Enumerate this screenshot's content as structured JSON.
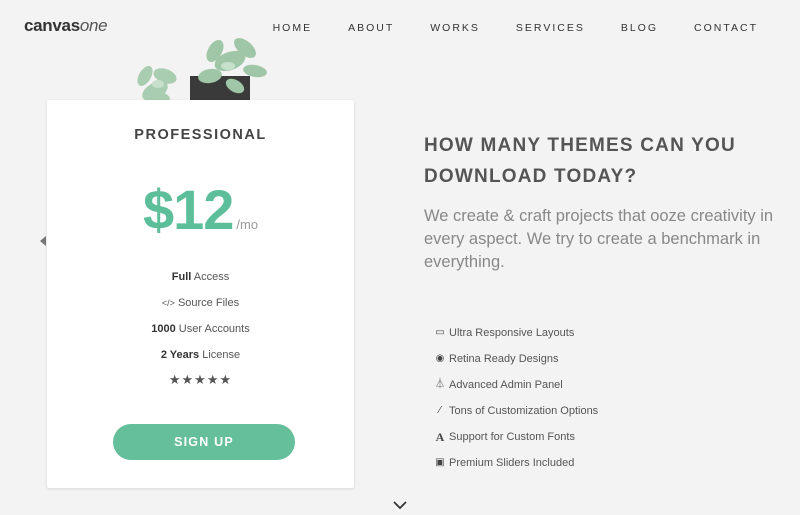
{
  "header": {
    "logo_bold": "canvas",
    "logo_italic": "one",
    "nav": [
      "HOME",
      "ABOUT",
      "WORKS",
      "SERVICES",
      "BLOG",
      "CONTACT"
    ]
  },
  "pricing": {
    "plan_name": "PROFESSIONAL",
    "price": "$12",
    "period": "/mo",
    "features": [
      {
        "strong": "Full",
        "text": " Access",
        "icon": ""
      },
      {
        "strong": "",
        "text": "Source Files",
        "icon": "</>"
      },
      {
        "strong": "1000",
        "text": " User Accounts",
        "icon": ""
      },
      {
        "strong": "2 Years",
        "text": " License",
        "icon": ""
      }
    ],
    "stars": "★★★★★",
    "rating": 5,
    "cta": "SIGN UP"
  },
  "content": {
    "headline": "HOW MANY THEMES CAN YOU DOWNLOAD TODAY?",
    "lead": "We create & craft projects that ooze creativity in every aspect. We try to create a benchmark in everything.",
    "list": [
      {
        "icon": "monitor-icon",
        "glyph": "▭",
        "text": "Ultra Responsive Layouts"
      },
      {
        "icon": "eye-icon",
        "glyph": "◉",
        "text": "Retina Ready Designs"
      },
      {
        "icon": "beaker-icon",
        "glyph": "⏃",
        "text": "Advanced Admin Panel"
      },
      {
        "icon": "magic-wand-icon",
        "glyph": "⁄",
        "text": "Tons of Customization Options"
      },
      {
        "icon": "font-icon",
        "glyph": "A",
        "text": "Support for Custom Fonts"
      },
      {
        "icon": "slider-icon",
        "glyph": "▣",
        "text": "Premium Sliders Included"
      }
    ]
  },
  "colors": {
    "accent": "#5dbf9a",
    "background": "#f3f3f3"
  }
}
